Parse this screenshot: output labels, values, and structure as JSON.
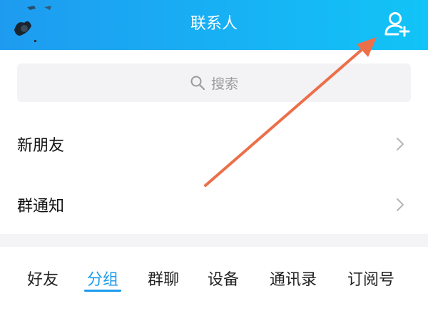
{
  "header": {
    "title": "联系人",
    "background_color": "#1e9bf0",
    "add_icon": "add-contact-icon"
  },
  "search": {
    "placeholder": "搜索",
    "icon": "search-icon"
  },
  "rows": [
    {
      "label": "新朋友",
      "icon": "chevron-right-icon"
    },
    {
      "label": "群通知",
      "icon": "chevron-right-icon"
    }
  ],
  "tabs": [
    {
      "label": "好友",
      "active": false
    },
    {
      "label": "分组",
      "active": true
    },
    {
      "label": "群聊",
      "active": false
    },
    {
      "label": "设备",
      "active": false
    },
    {
      "label": "通讯录",
      "active": false
    },
    {
      "label": "订阅号",
      "active": false
    }
  ],
  "colors": {
    "accent": "#1a9bec",
    "annotation_arrow": "#ec6f4a"
  }
}
